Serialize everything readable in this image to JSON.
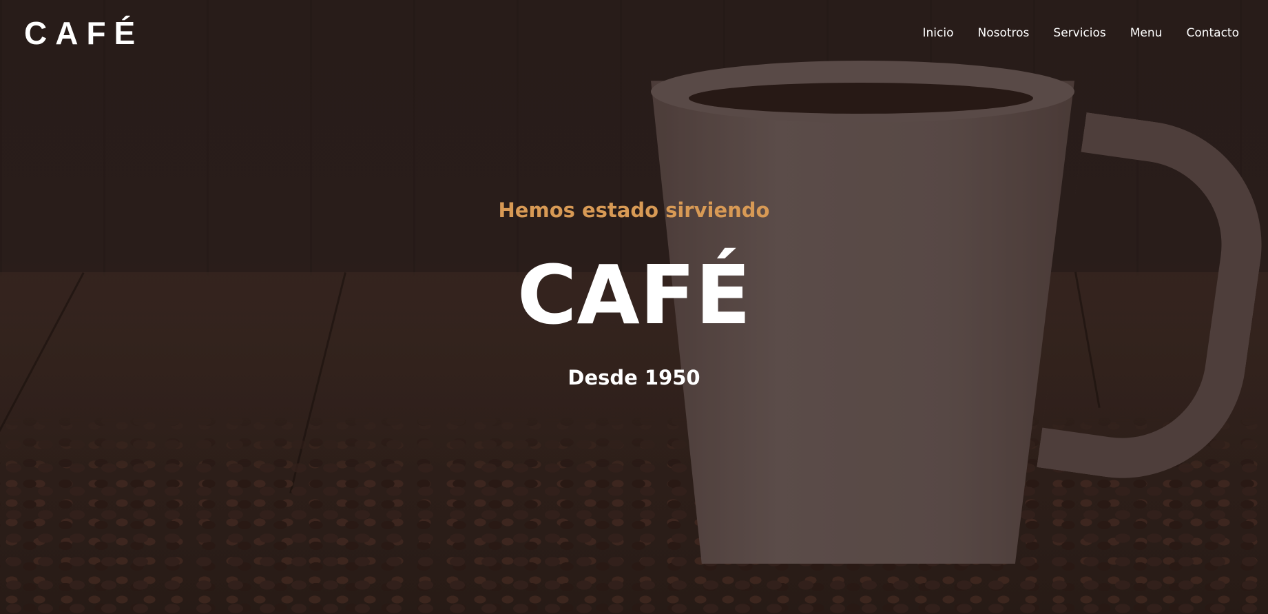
{
  "header": {
    "logo": "CAFÉ",
    "nav": [
      {
        "label": "Inicio"
      },
      {
        "label": "Nosotros"
      },
      {
        "label": "Servicios"
      },
      {
        "label": "Menu"
      },
      {
        "label": "Contacto"
      }
    ]
  },
  "hero": {
    "tagline": "Hemos estado sirviendo",
    "title": "CAFÉ",
    "since": "Desde 1950"
  },
  "colors": {
    "accent": "#d89a55",
    "text": "#ffffff",
    "background": "#2a1d1b"
  }
}
